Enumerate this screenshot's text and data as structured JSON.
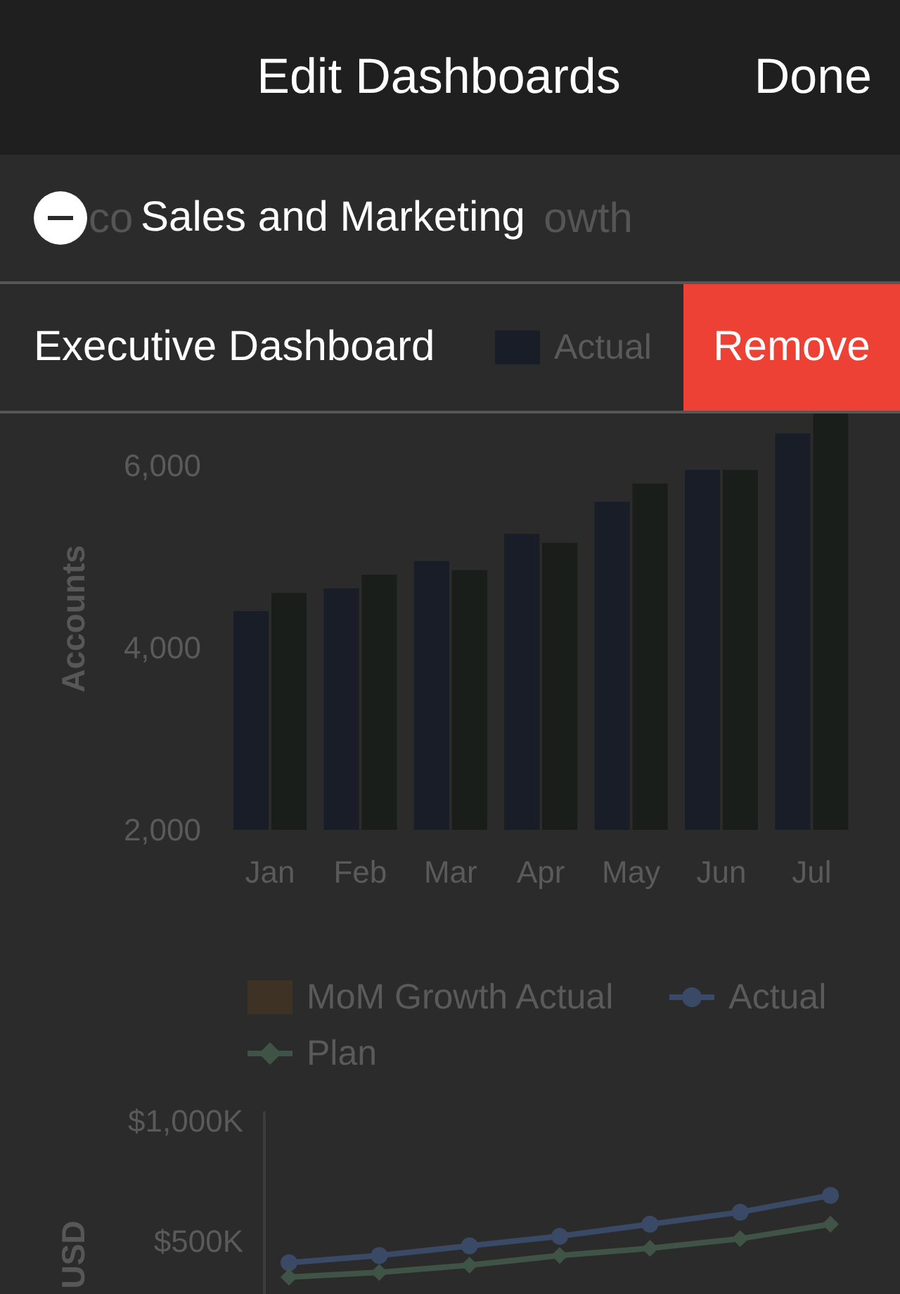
{
  "header": {
    "title": "Edit Dashboards",
    "done_button": "Done"
  },
  "dashboards": [
    {
      "name": "Sales and Marketing",
      "swiped": false
    },
    {
      "name": "Executive Dashboard",
      "swiped": true,
      "action": "Remove"
    }
  ],
  "background_dashboard": {
    "title_visible_parts": [
      "co",
      "owth"
    ],
    "bar_chart": {
      "chart_data": {
        "type": "bar",
        "ylabel": "Accounts",
        "categories": [
          "Jan",
          "Feb",
          "Mar",
          "Apr",
          "May",
          "Jun",
          "Jul"
        ],
        "ylim": [
          2000,
          6600
        ],
        "yticks": [
          {
            "value": 2000,
            "label": "2,000"
          },
          {
            "value": 4000,
            "label": "4,000"
          },
          {
            "value": 6000,
            "label": "6,000"
          }
        ],
        "series": [
          {
            "name": "Actual",
            "color": "#181d27",
            "values": [
              4400,
              4650,
              4950,
              5250,
              5600,
              5950,
              6350
            ]
          },
          {
            "color": "#191e1a",
            "values": [
              4600,
              4800,
              4850,
              5150,
              5800,
              5950,
              6600
            ]
          }
        ]
      }
    },
    "line_chart": {
      "chart_data": {
        "type": "line",
        "ylabel": "USD",
        "ylim": [
          280,
          1040
        ],
        "yticks": [
          {
            "value": 500,
            "label": "$500K"
          },
          {
            "value": 1000,
            "label": "$1,000K"
          }
        ],
        "series": [
          {
            "name": "MoM Growth Actual",
            "marker": "square",
            "color": "#3d3224",
            "values": [
              null,
              null,
              null,
              null,
              null,
              null,
              null
            ]
          },
          {
            "name": "Actual",
            "marker": "circle",
            "color": "#3a4a66",
            "values": [
              410,
              440,
              480,
              520,
              570,
              620,
              690
            ]
          },
          {
            "name": "Plan",
            "marker": "diamond",
            "color": "#3f5446",
            "values": [
              350,
              370,
              400,
              440,
              470,
              510,
              570
            ]
          }
        ]
      }
    }
  }
}
